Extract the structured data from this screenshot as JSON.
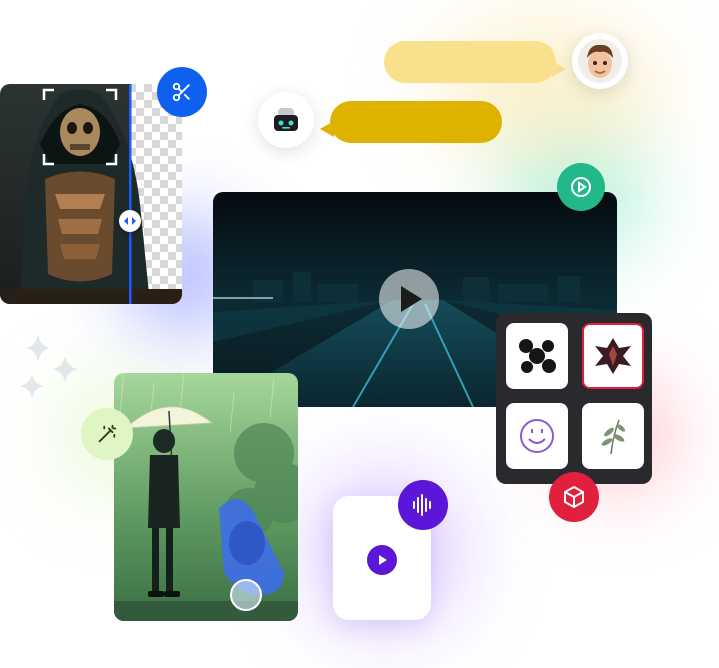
{
  "colors": {
    "accent_blue": "#1060f0",
    "accent_green": "#22b88a",
    "accent_purple": "#5b16d8",
    "accent_red": "#e0203c",
    "bubble_light": "#f8e08c",
    "bubble_dark": "#e0b200"
  },
  "icons": {
    "scissors": "scissors-icon",
    "play_circle": "play-circle-icon",
    "magic_wand": "magic-wand-icon",
    "audio_wave": "audio-wave-icon",
    "box3d": "cube-icon",
    "sparkles": "sparkles-icon"
  }
}
